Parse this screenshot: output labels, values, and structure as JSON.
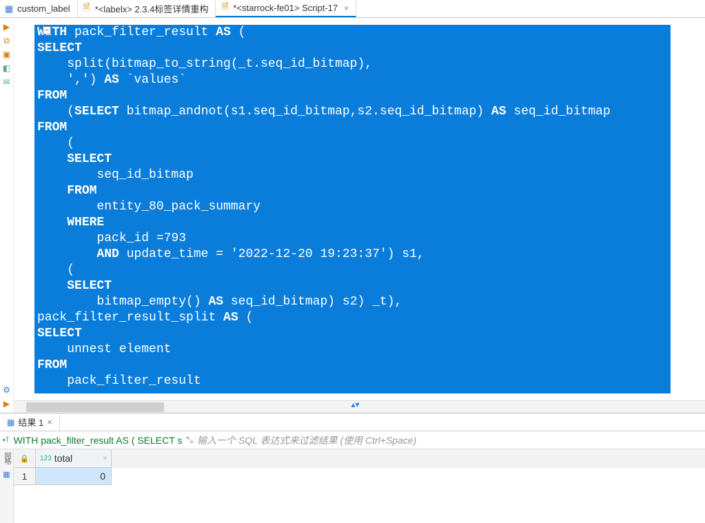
{
  "tabs": [
    {
      "label": "custom_label",
      "icon": "table",
      "dirty": false,
      "close": false
    },
    {
      "label": "*<labelx> 2.3.4标签详情重构",
      "icon": "sql",
      "dirty": true,
      "close": false
    },
    {
      "label": "*<starrock-fe01> Script-17",
      "icon": "sql",
      "dirty": true,
      "close": true,
      "active": true
    }
  ],
  "editor": {
    "lines": [
      "WITH pack_filter_result AS (",
      "SELECT",
      "    split(bitmap_to_string(_t.seq_id_bitmap),",
      "    ',') AS `values`",
      "FROM",
      "    (SELECT bitmap_andnot(s1.seq_id_bitmap,s2.seq_id_bitmap) AS seq_id_bitmap",
      "FROM",
      "    (",
      "    SELECT",
      "        seq_id_bitmap",
      "    FROM",
      "        entity_80_pack_summary",
      "    WHERE",
      "        pack_id =793",
      "        AND update_time = '2022-12-20 19:23:37') s1,",
      "    (",
      "    SELECT",
      "        bitmap_empty() AS seq_id_bitmap) s2) _t),",
      "pack_filter_result_split AS (",
      "SELECT",
      "    unnest element",
      "FROM",
      "    pack_filter_result"
    ],
    "keywords": [
      "WITH",
      "AS",
      "SELECT",
      "FROM",
      "WHERE",
      "AND"
    ]
  },
  "results": {
    "tab_label": "结果 1",
    "sql_preview": "WITH pack_filter_result AS ( SELECT s",
    "filter_placeholder": "输入一个 SQL 表达式来过滤结果 (使用 Ctrl+Space)",
    "column": {
      "name": "total",
      "type_prefix": "123"
    },
    "rows": [
      {
        "n": 1,
        "total": 0
      }
    ],
    "side_label": "网格"
  },
  "icons": {
    "table": "▦",
    "sql": "🗎",
    "close": "×",
    "minus": "−",
    "expand": "⤡",
    "lock": "🔒",
    "filter": "▿",
    "grid": "▦"
  },
  "colors": {
    "selection_bg": "#0a7ddb"
  }
}
